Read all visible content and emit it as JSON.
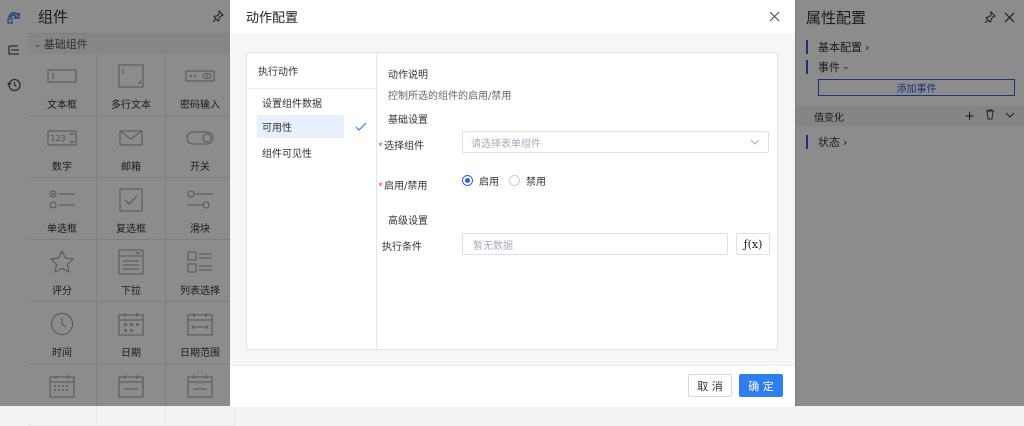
{
  "left_panel": {
    "title": "组件",
    "group": "基础组件",
    "components": [
      {
        "label": "文本框",
        "icon": "textbox-icon"
      },
      {
        "label": "多行文本",
        "icon": "textarea-icon"
      },
      {
        "label": "密码输入",
        "icon": "password-input-icon"
      },
      {
        "label": "数字",
        "icon": "number-icon"
      },
      {
        "label": "邮箱",
        "icon": "email-icon"
      },
      {
        "label": "开关",
        "icon": "switch-icon"
      },
      {
        "label": "单选框",
        "icon": "radio-icon"
      },
      {
        "label": "复选框",
        "icon": "checkbox-icon"
      },
      {
        "label": "滑块",
        "icon": "slider-icon"
      },
      {
        "label": "评分",
        "icon": "star-icon"
      },
      {
        "label": "下拉",
        "icon": "dropdown-icon"
      },
      {
        "label": "列表选择",
        "icon": "list-select-icon"
      },
      {
        "label": "时间",
        "icon": "clock-icon"
      },
      {
        "label": "日期",
        "icon": "calendar-icon"
      },
      {
        "label": "日期范围",
        "icon": "date-range-icon"
      },
      {
        "label": "",
        "icon": "calendar-grid-icon"
      },
      {
        "label": "",
        "icon": "calendar-icon"
      },
      {
        "label": "",
        "icon": "calendar-icon"
      }
    ],
    "number_icon_text": "123"
  },
  "right_panel": {
    "title": "属性配置",
    "basic_config": "基本配置",
    "events": "事件",
    "add_event": "添加事件",
    "event_value_change": "值变化",
    "status": "状态"
  },
  "modal": {
    "title": "动作配置",
    "actions_title": "执行动作",
    "actions": [
      "设置组件数据",
      "可用性",
      "组件可见性"
    ],
    "selected_action_index": 1,
    "desc_title": "动作说明",
    "desc_text": "控制所选的组件的启用/禁用",
    "basic_title": "基础设置",
    "select_component_label": "选择组件",
    "select_component_placeholder": "请选择表单组件",
    "enable_label": "启用/禁用",
    "radio_enable": "启用",
    "radio_disable": "禁用",
    "advanced_title": "高级设置",
    "condition_label": "执行条件",
    "condition_placeholder": "暂无数据",
    "fx_label": "ƒ(x)",
    "cancel": "取 消",
    "ok": "确 定"
  },
  "colors": {
    "primary": "#2d7ff0",
    "accent_bar": "#2d61e0",
    "required": "#e34d4d"
  }
}
